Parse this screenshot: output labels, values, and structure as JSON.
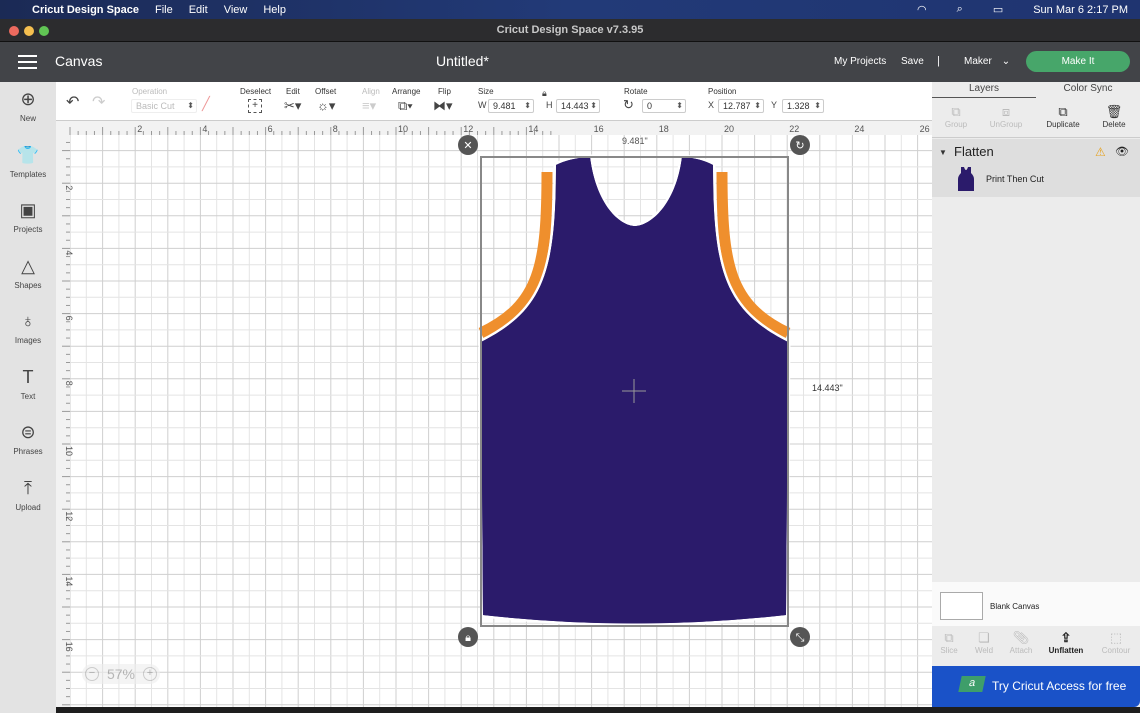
{
  "menubar": {
    "app": "Cricut Design Space",
    "items": [
      "File",
      "Edit",
      "View",
      "Help"
    ],
    "datetime": "Sun Mar 6  2:17 PM"
  },
  "window": {
    "title": "Cricut Design Space  v7.3.95"
  },
  "header": {
    "section": "Canvas",
    "doc_title": "Untitled*",
    "my_projects": "My Projects",
    "save": "Save",
    "separator": "|",
    "machine": "Maker",
    "make_it": "Make It"
  },
  "toolbar": {
    "operation_label": "Operation",
    "operation_value": "Basic Cut",
    "deselect": "Deselect",
    "edit": "Edit",
    "offset": "Offset",
    "align": "Align",
    "arrange": "Arrange",
    "flip": "Flip",
    "size": "Size",
    "w_label": "W",
    "w": "9.481",
    "h_label": "H",
    "h": "14.443",
    "rotate": "Rotate",
    "rotate_value": "0",
    "position": "Position",
    "x_label": "X",
    "x": "12.787",
    "y_label": "Y",
    "y": "1.328"
  },
  "sidebar": {
    "items": [
      {
        "label": "New",
        "icon": "⊕"
      },
      {
        "label": "Templates",
        "icon": "👕"
      },
      {
        "label": "Projects",
        "icon": "▣"
      },
      {
        "label": "Shapes",
        "icon": "△"
      },
      {
        "label": "Images",
        "icon": "♁"
      },
      {
        "label": "Text",
        "icon": "T"
      },
      {
        "label": "Phrases",
        "icon": "⊜"
      },
      {
        "label": "Upload",
        "icon": "⤒"
      }
    ]
  },
  "canvas": {
    "h_ruler": [
      "2",
      "4",
      "6",
      "8",
      "10",
      "12",
      "14",
      "16",
      "18",
      "20",
      "22",
      "24",
      "26"
    ],
    "v_ruler": [
      "2",
      "4",
      "6",
      "8",
      "10",
      "12",
      "14",
      "16",
      "18"
    ],
    "width_label": "9.481\"",
    "height_label": "14.443\"",
    "zoom": "57%",
    "colors": {
      "body": "#2b1b6b",
      "trim": "#ef8f2d"
    }
  },
  "panel": {
    "tabs": [
      "Layers",
      "Color Sync"
    ],
    "actions": [
      "Group",
      "UnGroup",
      "Duplicate",
      "Delete"
    ],
    "group_name": "Flatten",
    "layer_name": "Print Then Cut",
    "blank_canvas": "Blank Canvas",
    "bottom_actions": [
      "Slice",
      "Weld",
      "Attach",
      "Unflatten",
      "Contour"
    ],
    "promo": "Try Cricut Access for free"
  }
}
